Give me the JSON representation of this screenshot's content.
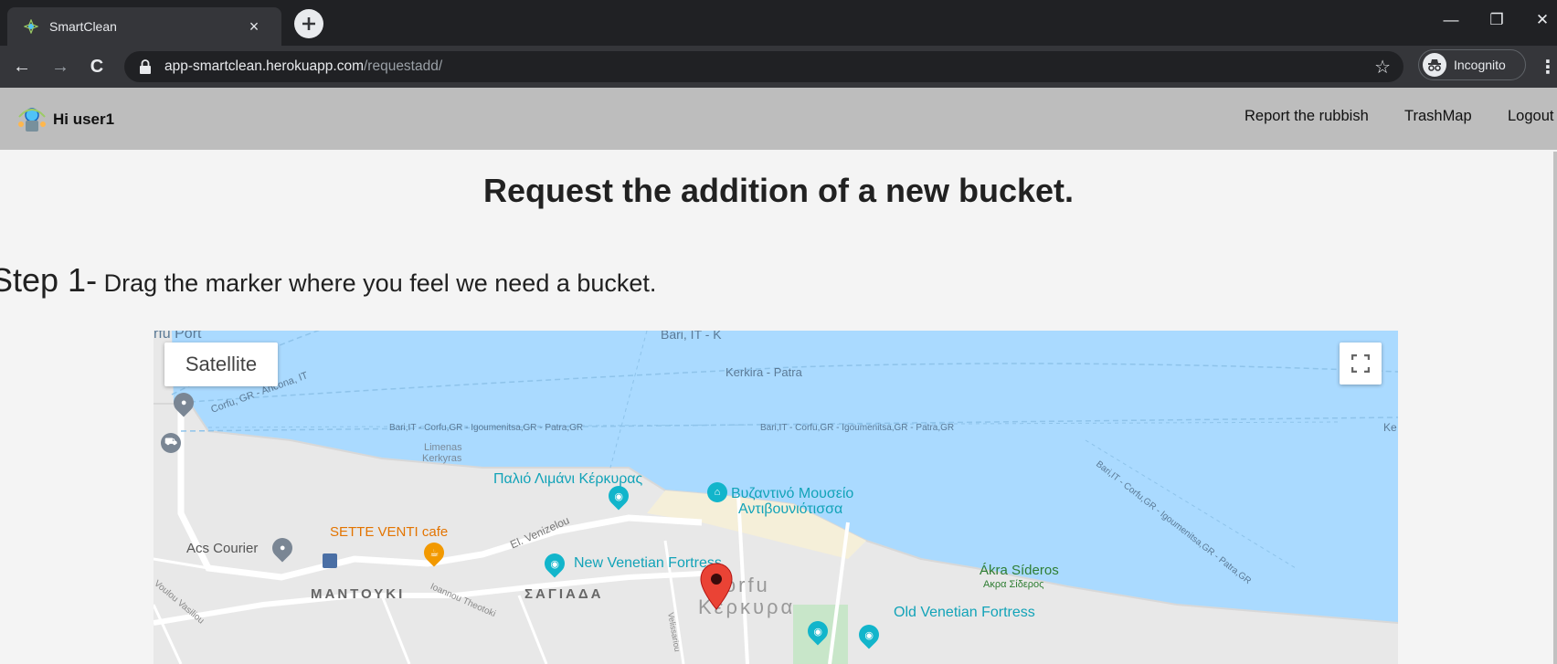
{
  "browser": {
    "tab_title": "SmartClean",
    "tab_close": "×",
    "new_tab": "+",
    "url_host": "app-smartclean.herokuapp.com",
    "url_path": "/requestadd/",
    "incognito_label": "Incognito",
    "window_controls": {
      "minimize": "—",
      "maximize": "❐",
      "close": "✕"
    },
    "nav": {
      "back": "←",
      "forward": "→",
      "reload": "C"
    },
    "bookmark": "☆",
    "menu": "⋮"
  },
  "navbar": {
    "greeting": "Hi user1",
    "links": [
      "Report the rubbish",
      "TrashMap",
      "Logout"
    ]
  },
  "page": {
    "title": "Request the addition of a new bucket.",
    "step_number": "Step 1-",
    "step_text": " Drag the marker where you feel we need a bucket."
  },
  "map": {
    "satellite_button": "Satellite",
    "labels": {
      "corfu_port": "rfu Port",
      "bari_top": "Bari, IT - K",
      "route_corfu_ancona": "Corfu, GR - Ancona, IT",
      "route_kerkyra_patra": "Kerkira - Patra",
      "route_bari_1": "Bari,IT - Corfu,GR - Igoumenitsa,GR - Patra,GR",
      "route_bari_2": "Bari,IT - Corfu,GR - Igoumenitsa,GR - Patra,GR",
      "route_bari_diag": "Bari,IT - Corfu,GR - Igoumenitsa,GR - Patra,GR",
      "ke": "Ke",
      "limenas": "Limenas",
      "kerkyras": "Kerkyras",
      "old_port": "Παλιό Λιμάνι Κέρκυρας",
      "byzantine_museum_1": "Βυζαντινό Μουσείο",
      "byzantine_museum_2": "Αντιβουνιότισσα",
      "sette_venti": "SETTE VENTI cafe",
      "acs_courier": "Acs Courier",
      "el_venizelou": "El. Venizelou",
      "new_fortress": "New Venetian Fortress",
      "akra_sideros": "Ákra Síderos",
      "akra_sideros_gr": "Ακρα Σίδερος",
      "mantouki": "ΜΑΝΤΟΥΚΙ",
      "sagiada": "ΣΑΓΙΑΔΑ",
      "corfu_latin": "Corfu",
      "corfu_greek": "Κέρκυρα",
      "old_fortress": "Old Venetian Fortress",
      "ioannou": "Ioannou Theotoki",
      "voulou": "Voulou Vasiliou",
      "velissariou": "Velissariou"
    },
    "colors": {
      "water": "#aadaff",
      "land": "#e8e8e8",
      "road": "#ffffff",
      "poi_teal": "#12b5cb",
      "poi_orange": "#f29900",
      "poi_gray": "#7a8694",
      "marker": "#ea4335",
      "park": "#c8e6c9"
    }
  }
}
